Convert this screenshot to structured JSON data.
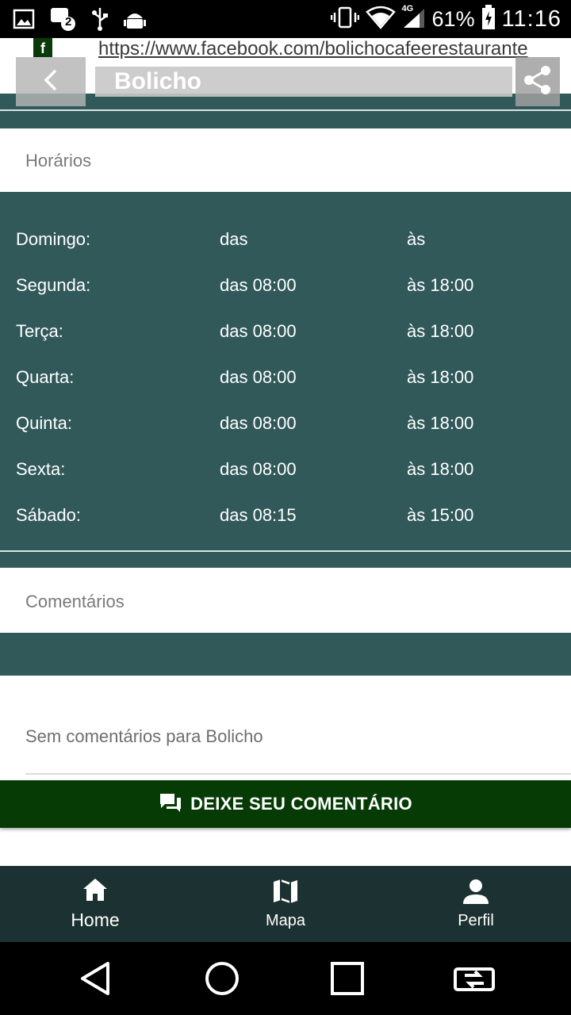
{
  "status_bar": {
    "battery": "61%",
    "time": "11:16",
    "network": "4G",
    "icons": [
      "image-icon",
      "notification-count-icon",
      "usb-icon",
      "android-debug-icon",
      "vibrate-icon",
      "wifi-icon",
      "signal-icon",
      "battery-charging-icon"
    ],
    "notification_count": "2"
  },
  "header": {
    "facebook_icon_letter": "f",
    "facebook_url": "https://www.facebook.com/bolichocafeerestaurante",
    "title": "Bolicho",
    "back_icon": "chevron-left-icon",
    "share_icon": "share-icon"
  },
  "hours_section": {
    "title": "Horários",
    "rows": [
      {
        "day": "Domingo:",
        "from": "das",
        "to": "às"
      },
      {
        "day": "Segunda:",
        "from": "das 08:00",
        "to": "às 18:00"
      },
      {
        "day": "Terça:",
        "from": "das 08:00",
        "to": "às 18:00"
      },
      {
        "day": "Quarta:",
        "from": "das 08:00",
        "to": "às 18:00"
      },
      {
        "day": "Quinta:",
        "from": "das 08:00",
        "to": "às 18:00"
      },
      {
        "day": "Sexta:",
        "from": "das 08:00",
        "to": "às 18:00"
      },
      {
        "day": "Sábado:",
        "from": "das 08:15",
        "to": "às 15:00"
      }
    ]
  },
  "comments_section": {
    "title": "Comentários",
    "empty_text": "Sem comentários para Bolicho",
    "button_label": "DEIXE SEU COMENTÁRIO",
    "button_icon": "comments-icon"
  },
  "bottom_nav": {
    "items": [
      {
        "label": "Home",
        "icon": "home-icon",
        "active": true
      },
      {
        "label": "Mapa",
        "icon": "map-icon",
        "active": false
      },
      {
        "label": "Perfil",
        "icon": "person-icon",
        "active": false
      }
    ]
  },
  "system_nav": {
    "buttons": [
      "back-triangle-icon",
      "home-circle-icon",
      "recents-square-icon",
      "switch-app-icon"
    ]
  },
  "colors": {
    "teal": "#32595a",
    "dark_green_button": "#063b06",
    "bottom_nav_bg": "#1c3131"
  }
}
